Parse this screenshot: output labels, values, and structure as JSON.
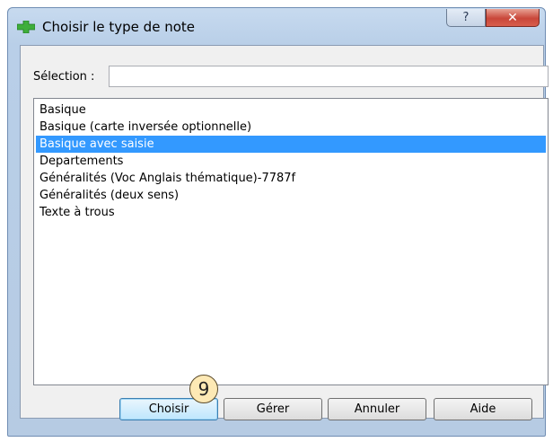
{
  "window": {
    "title": "Choisir le type de note",
    "help_glyph": "?",
    "close_glyph": "✕",
    "icon": "green-cross-plus-icon"
  },
  "selection": {
    "label": "Sélection :",
    "value": "",
    "placeholder": ""
  },
  "list": {
    "items": [
      {
        "label": "Basique",
        "selected": false
      },
      {
        "label": "Basique (carte inversée optionnelle)",
        "selected": false
      },
      {
        "label": "Basique avec saisie",
        "selected": true
      },
      {
        "label": "Departements",
        "selected": false
      },
      {
        "label": "Généralités (Voc Anglais thématique)-7787f",
        "selected": false
      },
      {
        "label": "Généralités (deux sens)",
        "selected": false
      },
      {
        "label": "Texte à trous",
        "selected": false
      }
    ]
  },
  "buttons": {
    "choose": "Choisir",
    "manage": "Gérer",
    "cancel": "Annuler",
    "help": "Aide"
  },
  "annotation": {
    "step_number": "9"
  },
  "colors": {
    "selection_bg": "#3399ff",
    "badge_bg": "#fde9b5",
    "close_red": "#c9473a"
  }
}
